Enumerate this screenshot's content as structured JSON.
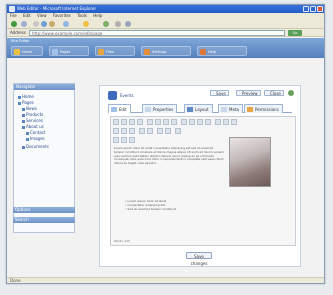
{
  "window": {
    "title": "Web Editor - Microsoft Internet Explorer"
  },
  "menu": [
    "File",
    "Edit",
    "View",
    "Favorites",
    "Tools",
    "Help"
  ],
  "address": {
    "label": "Address",
    "value": "http://www.example.com/edit/page",
    "go": "Go"
  },
  "app": {
    "title": "Site Editor",
    "buttons": [
      "Home",
      "Pages",
      "Files",
      "Settings",
      "Help"
    ]
  },
  "sidebar": {
    "header": "Navigator",
    "items": [
      "Home",
      "Pages",
      "News",
      "Products",
      "Services",
      "About us",
      "Contact",
      "Images",
      "Documents"
    ],
    "header2": "Options",
    "header3": "Search"
  },
  "document": {
    "title": "Events",
    "actions": [
      "Save",
      "Preview",
      "Close"
    ],
    "tabs": [
      "Edit",
      "Properties",
      "Layout",
      "Meta",
      "Permissions"
    ],
    "body_text": "Lorem ipsum dolor sit amet consectetur adipiscing elit sed do eiusmod tempor incididunt ut labore et dolore magna aliqua. Ut enim ad minim veniam quis nostrud exercitation ullamco laboris nisi ut aliquip ex ea commodo consequat. Duis aute irure dolor in reprehenderit in voluptate velit esse cillum dolore eu fugiat nulla pariatur.",
    "list": [
      "Lorem ipsum dolor sit amet",
      "Consectetur adipiscing elit",
      "Sed do eiusmod tempor incididunt"
    ],
    "status_left": "Words: 120",
    "save_label": "Save changes"
  },
  "statusbar": {
    "text": "Done"
  }
}
